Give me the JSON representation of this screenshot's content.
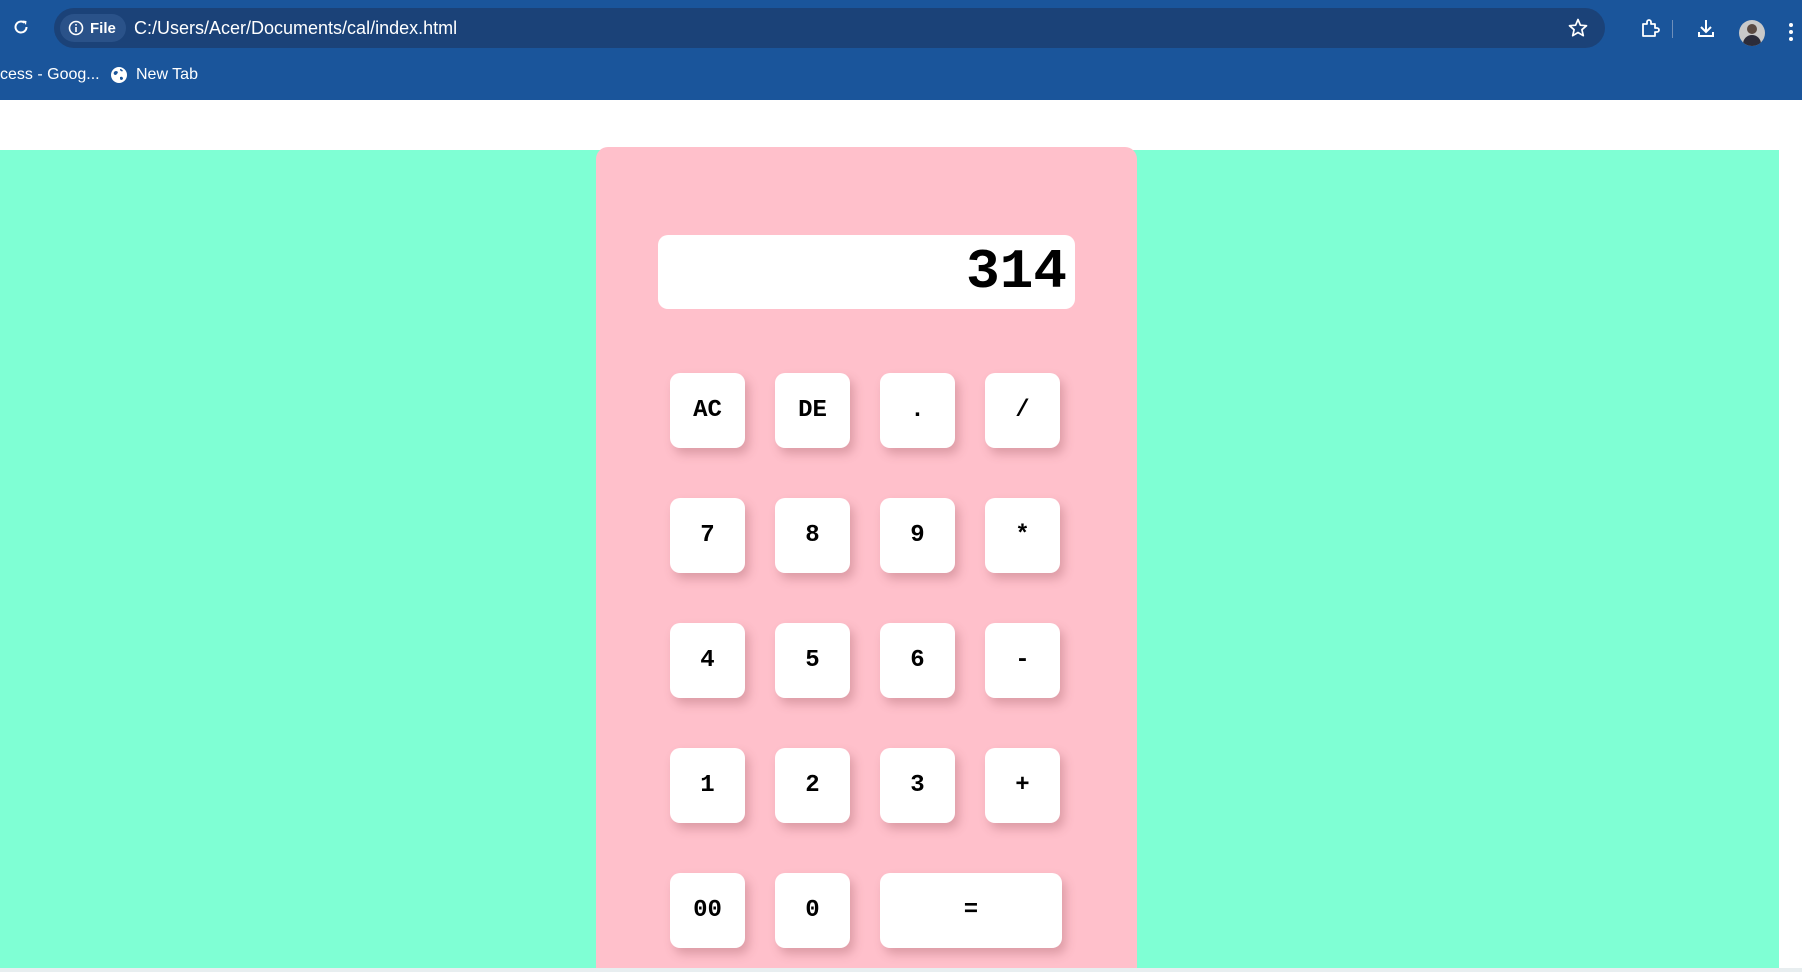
{
  "browser": {
    "site_chip_label": "File",
    "url": "C:/Users/Acer/Documents/cal/index.html",
    "bookmarks": [
      {
        "label": "cess - Goog..."
      },
      {
        "label": "New Tab"
      }
    ]
  },
  "calculator": {
    "display_value": "314",
    "keys": [
      {
        "label": "AC"
      },
      {
        "label": "DE"
      },
      {
        "label": "."
      },
      {
        "label": "/"
      },
      {
        "label": "7"
      },
      {
        "label": "8"
      },
      {
        "label": "9"
      },
      {
        "label": "*"
      },
      {
        "label": "4"
      },
      {
        "label": "5"
      },
      {
        "label": "6"
      },
      {
        "label": "-"
      },
      {
        "label": "1"
      },
      {
        "label": "2"
      },
      {
        "label": "3"
      },
      {
        "label": "+"
      },
      {
        "label": "00"
      },
      {
        "label": "0"
      },
      {
        "label": "="
      }
    ]
  },
  "colors": {
    "browser_chrome": "#1a559b",
    "omnibox": "#1b4278",
    "page_background": "#7fffd4",
    "calculator_body": "#ffc0cb",
    "key_background": "#ffffff"
  },
  "icons": {
    "reload": "reload-icon",
    "site_info": "info-icon",
    "bookmark_star": "star-icon",
    "extensions": "extensions-icon",
    "downloads": "download-icon",
    "profile": "avatar",
    "menu": "kebab-menu-icon",
    "new_tab_bookmark": "globe-icon"
  }
}
